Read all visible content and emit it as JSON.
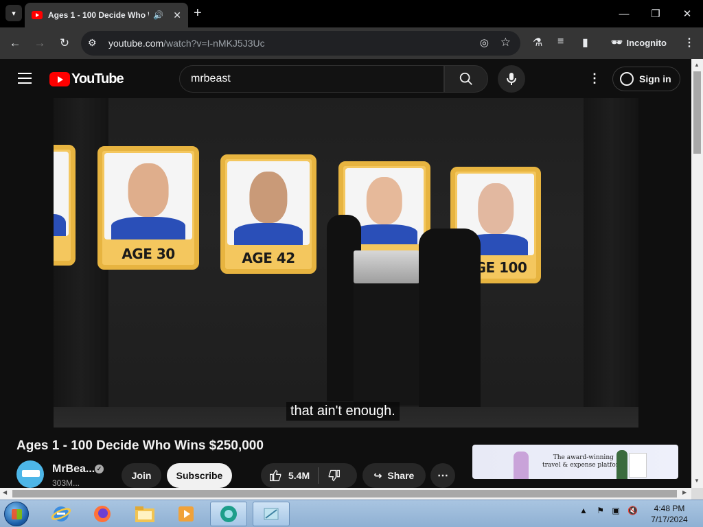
{
  "browser": {
    "tab_title": "Ages 1 - 100 Decide Who Wins $250,000",
    "url_host": "youtube.com",
    "url_path": "/watch?v=I-nMKJ5J3Uc",
    "incognito_label": "Incognito"
  },
  "youtube": {
    "logo_text": "YouTube",
    "search_value": "mrbeast",
    "signin_label": "Sign in"
  },
  "video": {
    "caption": "that ain't enough.",
    "cards": [
      {
        "label": ""
      },
      {
        "label": "AGE 30"
      },
      {
        "label": "AGE 42"
      },
      {
        "label": ""
      },
      {
        "label": "AGE 100"
      }
    ]
  },
  "details": {
    "title": "Ages 1 - 100 Decide Who Wins $250,000",
    "channel_name": "MrBea...",
    "subscribers": "303M...",
    "join_label": "Join",
    "subscribe_label": "Subscribe",
    "likes": "5.4M",
    "share_label": "Share"
  },
  "ad": {
    "text_line1": "The award-winning",
    "text_line2": "travel & expense platform"
  },
  "taskbar": {
    "time": "4:48 PM",
    "date": "7/17/2024"
  }
}
